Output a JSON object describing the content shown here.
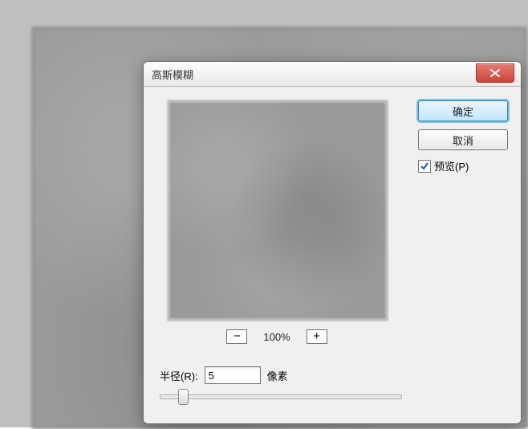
{
  "dialog": {
    "title": "高斯模糊",
    "close_icon": "close"
  },
  "buttons": {
    "ok": "确定",
    "cancel": "取消"
  },
  "preview_checkbox": {
    "checked": true,
    "label": "预览(P)"
  },
  "zoom": {
    "minus": "−",
    "plus": "+",
    "level": "100%"
  },
  "radius": {
    "label": "半径(R):",
    "value": "5",
    "unit": "像素",
    "slider_percent": 8
  }
}
